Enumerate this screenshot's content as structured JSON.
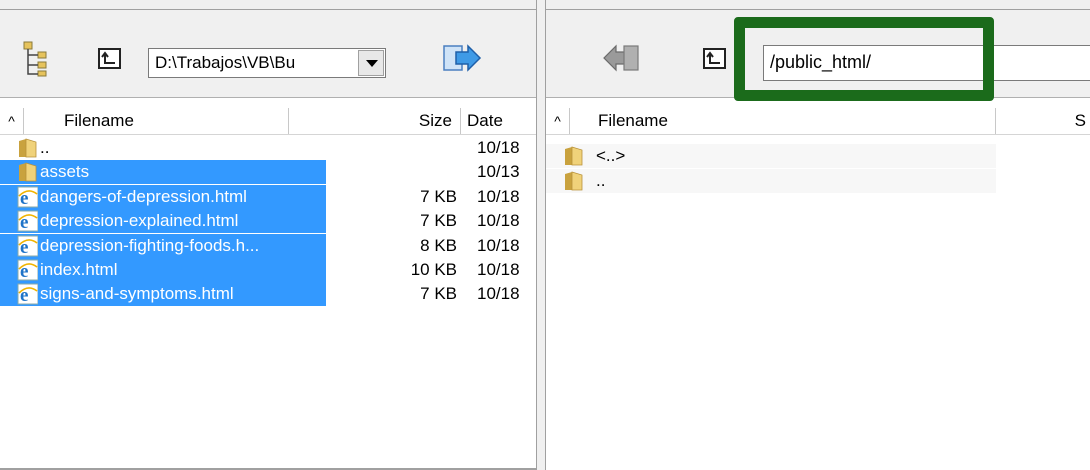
{
  "left": {
    "path": "D:\\Trabajos\\VB\\Bu",
    "columns": {
      "sort": "^",
      "filename": "Filename",
      "size": "Size",
      "date": "Date"
    },
    "rows": [
      {
        "name": "..",
        "size": "",
        "date": "10/18",
        "type": "folder",
        "selected": false
      },
      {
        "name": "assets",
        "size": "",
        "date": "10/13",
        "type": "folder",
        "selected": true
      },
      {
        "name": "dangers-of-depression.html",
        "size": "7 KB",
        "date": "10/18",
        "type": "html",
        "selected": true
      },
      {
        "name": "depression-explained.html",
        "size": "7 KB",
        "date": "10/18",
        "type": "html",
        "selected": true
      },
      {
        "name": "depression-fighting-foods.h...",
        "size": "8 KB",
        "date": "10/18",
        "type": "html",
        "selected": true
      },
      {
        "name": "index.html",
        "size": "10 KB",
        "date": "10/18",
        "type": "html",
        "selected": true
      },
      {
        "name": "signs-and-symptoms.html",
        "size": "7 KB",
        "date": "10/18",
        "type": "html",
        "selected": true
      }
    ]
  },
  "right": {
    "path": "/public_html/",
    "columns": {
      "sort": "^",
      "filename": "Filename",
      "size": "S"
    },
    "rows": [
      {
        "name": "<..>",
        "type": "folder"
      },
      {
        "name": "..",
        "type": "folder"
      }
    ]
  },
  "colors": {
    "selection": "#3399ff",
    "highlight": "#1b6b1b",
    "folder": "#e6c35c"
  }
}
